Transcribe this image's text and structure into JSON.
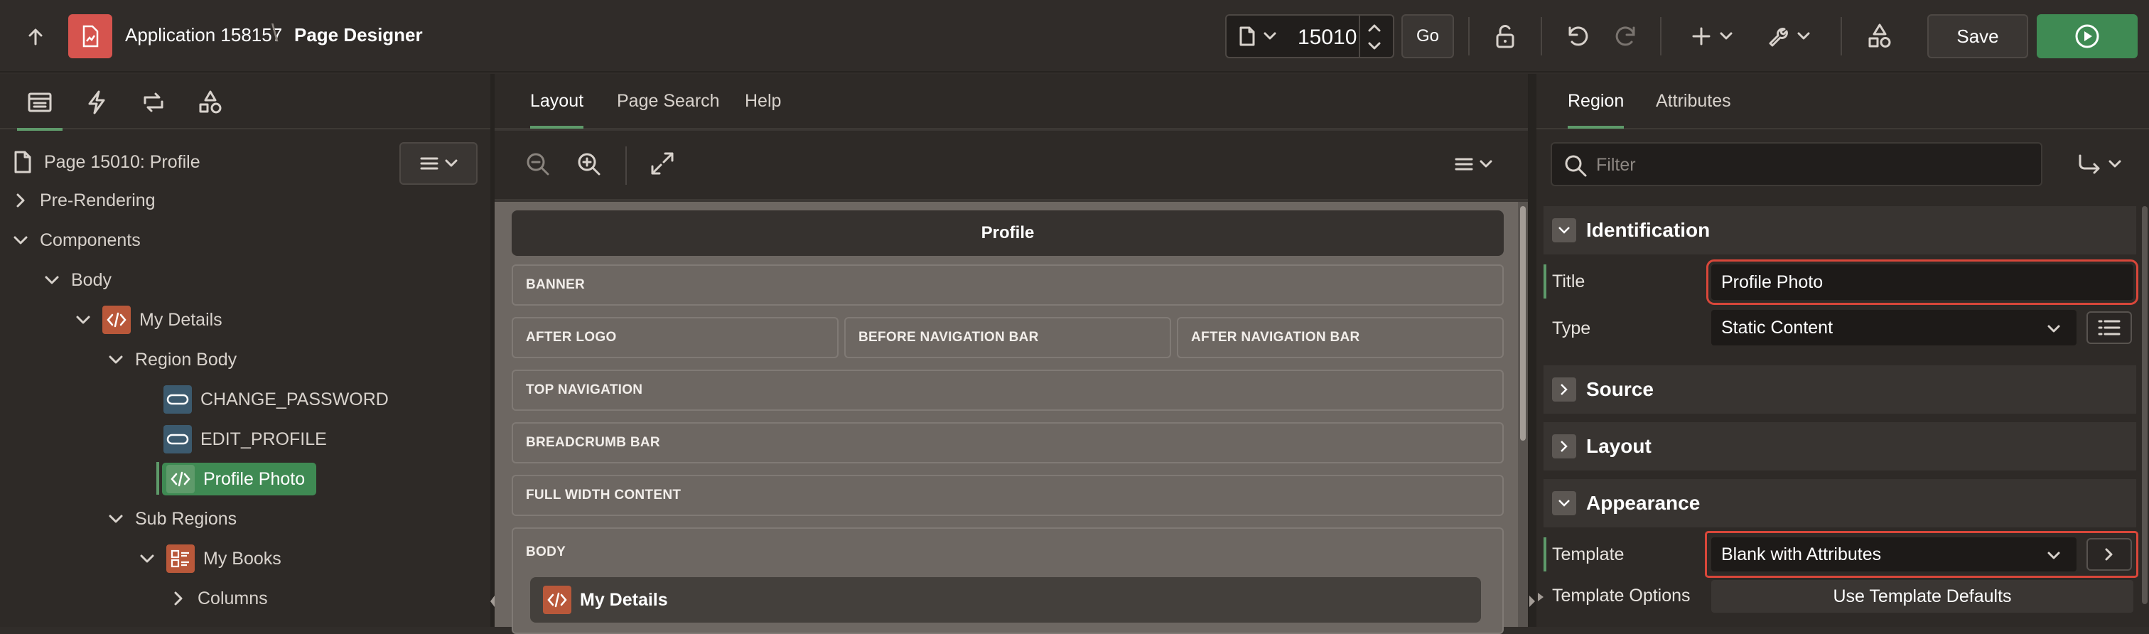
{
  "header": {
    "app_name": "Application 158157",
    "separator": "\\",
    "designer_title": "Page Designer",
    "page_number": "15010",
    "go_label": "Go",
    "save_label": "Save"
  },
  "left": {
    "root_label": "Page 15010: Profile",
    "tree": {
      "pre_rendering": "Pre-Rendering",
      "components": "Components",
      "body": "Body",
      "my_details": "My Details",
      "region_body": "Region Body",
      "change_password": "CHANGE_PASSWORD",
      "edit_profile": "EDIT_PROFILE",
      "profile_photo": "Profile Photo",
      "sub_regions": "Sub Regions",
      "my_books": "My Books",
      "columns": "Columns"
    }
  },
  "center": {
    "tabs": [
      "Layout",
      "Page Search",
      "Help"
    ],
    "page_title": "Profile",
    "slots": {
      "banner": "BANNER",
      "after_logo": "AFTER LOGO",
      "before_nav": "BEFORE NAVIGATION BAR",
      "after_nav": "AFTER NAVIGATION BAR",
      "top_nav": "TOP NAVIGATION",
      "breadcrumb": "BREADCRUMB BAR",
      "full_width": "FULL WIDTH CONTENT",
      "body": "BODY"
    },
    "body_region": "My Details"
  },
  "right": {
    "tabs": [
      "Region",
      "Attributes"
    ],
    "filter_placeholder": "Filter",
    "sections": {
      "identification": "Identification",
      "source": "Source",
      "layout": "Layout",
      "appearance": "Appearance"
    },
    "props": {
      "title_label": "Title",
      "title_value": "Profile Photo",
      "type_label": "Type",
      "type_value": "Static Content",
      "template_label": "Template",
      "template_value": "Blank with Attributes",
      "template_options_label": "Template Options",
      "template_options_value": "Use Template Defaults"
    }
  },
  "colors": {
    "accent_green": "#3f8a53",
    "app_badge_red": "#d6544e",
    "highlight_red": "#d9473a"
  }
}
